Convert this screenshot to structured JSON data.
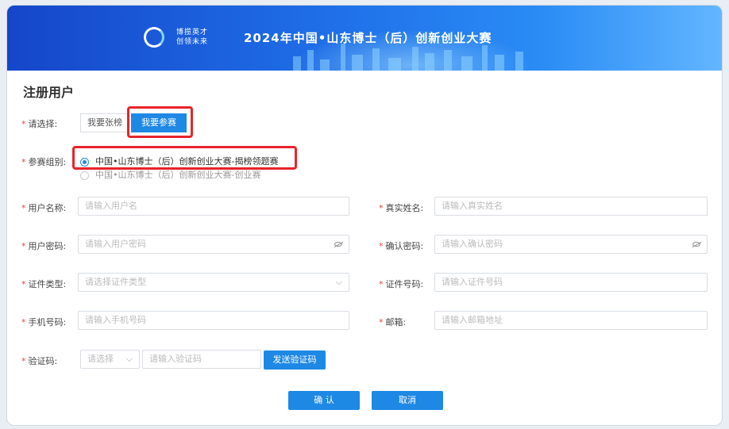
{
  "banner": {
    "slogan_line1": "博揽英才",
    "slogan_line2": "创领未来",
    "title": "2024年中国•山东博士（后）创新创业大赛"
  },
  "form": {
    "title": "注册用户",
    "choose": {
      "label": "请选择:",
      "options": [
        "我要张榜",
        "我要参赛"
      ],
      "selected": "我要参赛"
    },
    "group": {
      "label": "参赛组别:",
      "options": [
        "中国•山东博士（后）创新创业大赛-揭榜领题赛",
        "中国•山东博士（后）创新创业大赛-创业赛"
      ],
      "selected": "中国•山东博士（后）创新创业大赛-揭榜领题赛"
    },
    "fields": {
      "username": {
        "label": "用户名称:",
        "placeholder": "请输入用户名"
      },
      "realname": {
        "label": "真实姓名:",
        "placeholder": "请输入真实姓名"
      },
      "password": {
        "label": "用户密码:",
        "placeholder": "请输入用户密码"
      },
      "confirm_password": {
        "label": "确认密码:",
        "placeholder": "请输入确认密码"
      },
      "id_type": {
        "label": "证件类型:",
        "placeholder": "请选择证件类型"
      },
      "id_number": {
        "label": "证件号码:",
        "placeholder": "请输入证件号码"
      },
      "phone": {
        "label": "手机号码:",
        "placeholder": "请输入手机号码"
      },
      "email": {
        "label": "邮箱:",
        "placeholder": "请输入邮箱地址"
      },
      "captcha": {
        "label": "验证码:",
        "select_placeholder": "请选择",
        "placeholder": "请输入验证码",
        "send_button": "发送验证码"
      }
    },
    "required_mark": "*",
    "confirm_button": "确 认",
    "cancel_button": "取消"
  },
  "colors": {
    "accent": "#1e88e5",
    "required": "#e54545",
    "highlight_box": "#e8242a"
  },
  "icons": {
    "password_toggle": "eye-slash-icon",
    "select_arrow": "chevron-down-icon"
  }
}
